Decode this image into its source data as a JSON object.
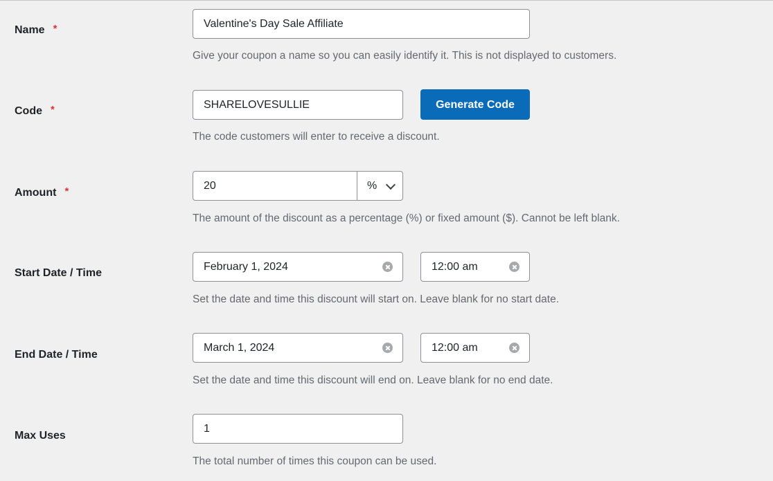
{
  "form": {
    "name": {
      "label": "Name",
      "required_mark": "*",
      "value": "Valentine's Day Sale Affiliate",
      "help": "Give your coupon a name so you can easily identify it. This is not displayed to customers."
    },
    "code": {
      "label": "Code",
      "required_mark": "*",
      "value": "SHARELOVESULLIE",
      "generate_label": "Generate Code",
      "help": "The code customers will enter to receive a discount."
    },
    "amount": {
      "label": "Amount",
      "required_mark": "*",
      "value": "20",
      "unit": "%",
      "help": "The amount of the discount as a percentage (%) or fixed amount ($). Cannot be left blank."
    },
    "start": {
      "label": "Start Date / Time",
      "date": "February 1, 2024",
      "time": "12:00 am",
      "help": "Set the date and time this discount will start on. Leave blank for no start date."
    },
    "end": {
      "label": "End Date / Time",
      "date": "March 1, 2024",
      "time": "12:00 am",
      "help": "Set the date and time this discount will end on. Leave blank for no end date."
    },
    "max_uses": {
      "label": "Max Uses",
      "value": "1",
      "help": "The total number of times this coupon can be used."
    }
  },
  "colors": {
    "background": "#f0f0f1",
    "primary_button": "#0a6bb8",
    "required": "#d63638",
    "help_text": "#646970"
  }
}
